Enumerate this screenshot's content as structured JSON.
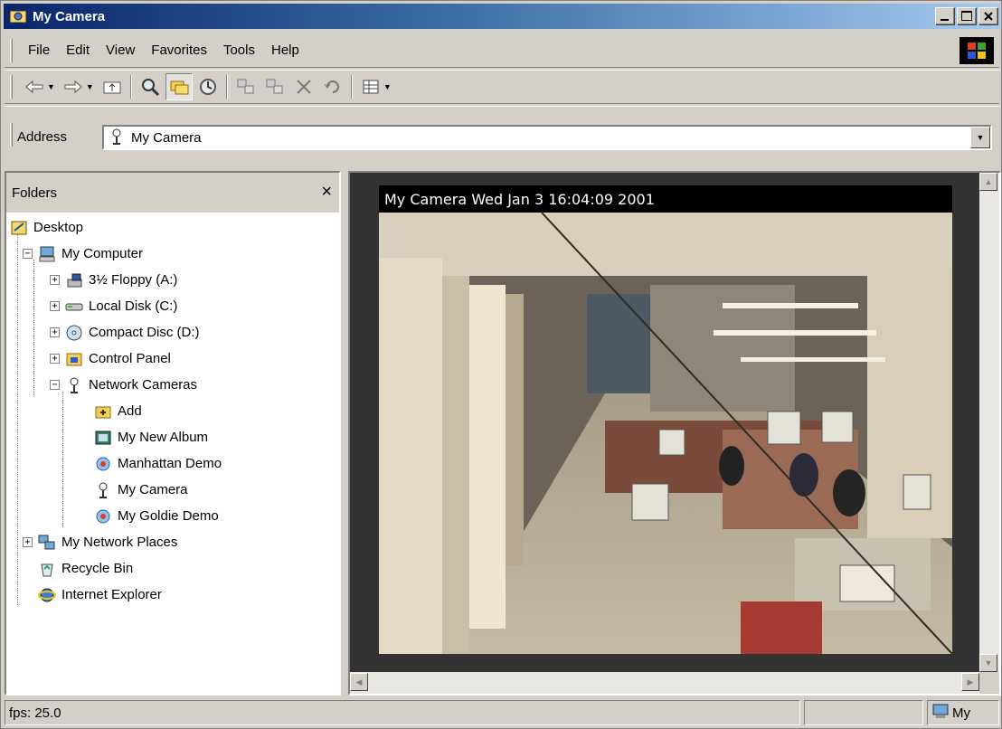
{
  "window": {
    "title": "My Camera"
  },
  "menu": {
    "items": [
      "File",
      "Edit",
      "View",
      "Favorites",
      "Tools",
      "Help"
    ]
  },
  "toolbar": {
    "buttons": [
      "back-icon",
      "forward-icon",
      "up-folder-icon",
      "search-icon",
      "folders-icon",
      "history-icon",
      "move-to-icon",
      "copy-to-icon",
      "delete-icon",
      "undo-icon",
      "views-icon"
    ]
  },
  "address": {
    "label": "Address",
    "value": "My Camera"
  },
  "folders": {
    "title": "Folders",
    "close": "×",
    "tree": [
      {
        "label": "Desktop",
        "icon": "desktop-icon"
      },
      {
        "label": "My Computer",
        "icon": "computer-icon",
        "expander": "−"
      },
      {
        "label": "3½ Floppy (A:)",
        "icon": "floppy-icon",
        "expander": "+"
      },
      {
        "label": "Local Disk (C:)",
        "icon": "disk-icon",
        "expander": "+"
      },
      {
        "label": "Compact Disc (D:)",
        "icon": "cd-icon",
        "expander": "+"
      },
      {
        "label": "Control Panel",
        "icon": "control-panel-icon",
        "expander": "+"
      },
      {
        "label": "Network Cameras",
        "icon": "network-camera-icon",
        "expander": "−"
      },
      {
        "label": "Add",
        "icon": "add-folder-icon"
      },
      {
        "label": "My New Album",
        "icon": "album-icon"
      },
      {
        "label": "Manhattan Demo",
        "icon": "camera-demo-icon"
      },
      {
        "label": "My Camera",
        "icon": "camera-icon"
      },
      {
        "label": "My Goldie Demo",
        "icon": "camera-demo-icon"
      },
      {
        "label": "My Network Places",
        "icon": "network-places-icon",
        "expander": "+"
      },
      {
        "label": "Recycle Bin",
        "icon": "recycle-bin-icon"
      },
      {
        "label": "Internet Explorer",
        "icon": "internet-explorer-icon"
      }
    ]
  },
  "camera": {
    "overlay": "My Camera Wed Jan  3 16:04:09 2001"
  },
  "status": {
    "fps": "fps: 25.0",
    "zone": "My"
  }
}
